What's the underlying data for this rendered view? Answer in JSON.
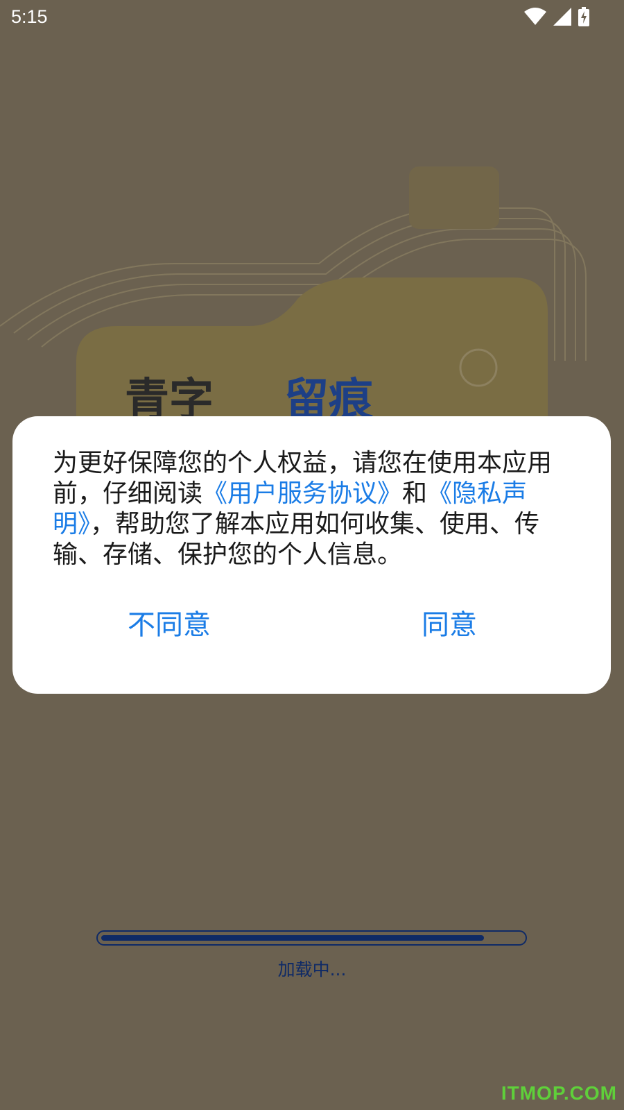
{
  "status_bar": {
    "time": "5:15",
    "icons": [
      "wifi-icon",
      "signal-icon",
      "battery-charging-icon"
    ]
  },
  "dialog": {
    "text_segments": [
      {
        "text": "为更好保障您的个人权益，请您在使用本应用前，仔细阅读",
        "type": "plain"
      },
      {
        "text": "《用户服务协议》",
        "type": "link"
      },
      {
        "text": "和",
        "type": "plain"
      },
      {
        "text": "《隐私声明》",
        "type": "link"
      },
      {
        "text": "，帮助您了解本应用如何收集、使用、传输、存储、保护您的个人信息。",
        "type": "plain"
      }
    ],
    "disagree_label": "不同意",
    "agree_label": "同意"
  },
  "loading": {
    "progress": 0.91,
    "label": "加载中..."
  },
  "watermark": "ITMOP.COM",
  "colors": {
    "link": "#1a7ce6",
    "progress": "#0f2a66",
    "background": "#6b6150",
    "dialog": "#ffffff"
  }
}
